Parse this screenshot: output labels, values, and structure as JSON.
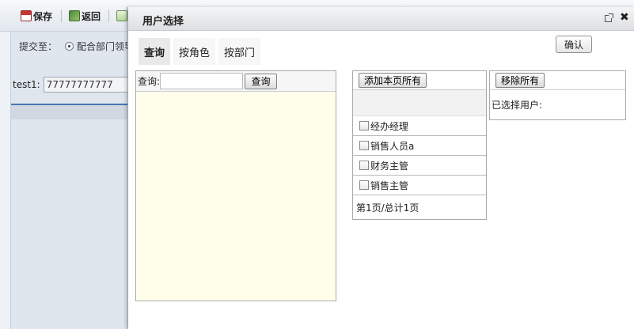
{
  "toolbar": {
    "save_label": "保存",
    "back_label": "返回"
  },
  "form": {
    "submit_to_label": "提交至：",
    "radio_option_label": "配合部门领导",
    "test_label": "test1:",
    "test_value": "77777777777"
  },
  "modal": {
    "title": "用户选择",
    "confirm_label": "确认",
    "tabs": [
      {
        "label": "查询",
        "active": true
      },
      {
        "label": "按角色",
        "active": false
      },
      {
        "label": "按部门",
        "active": false
      }
    ],
    "search": {
      "label": "查询:",
      "button_label": "查询",
      "input_value": ""
    },
    "role_panel": {
      "add_all_label": "添加本页所有",
      "items": [
        {
          "label": "经办经理"
        },
        {
          "label": "销售人员a"
        },
        {
          "label": "财务主管"
        },
        {
          "label": "销售主管"
        }
      ],
      "pager_text": "第1页/总计1页"
    },
    "selected_panel": {
      "remove_all_label": "移除所有",
      "selected_label": "已选择用户:"
    }
  },
  "icons": {
    "save": "save-icon",
    "back": "back-icon",
    "doc": "document-icon",
    "popout": "popout-icon",
    "close": "close-icon"
  }
}
